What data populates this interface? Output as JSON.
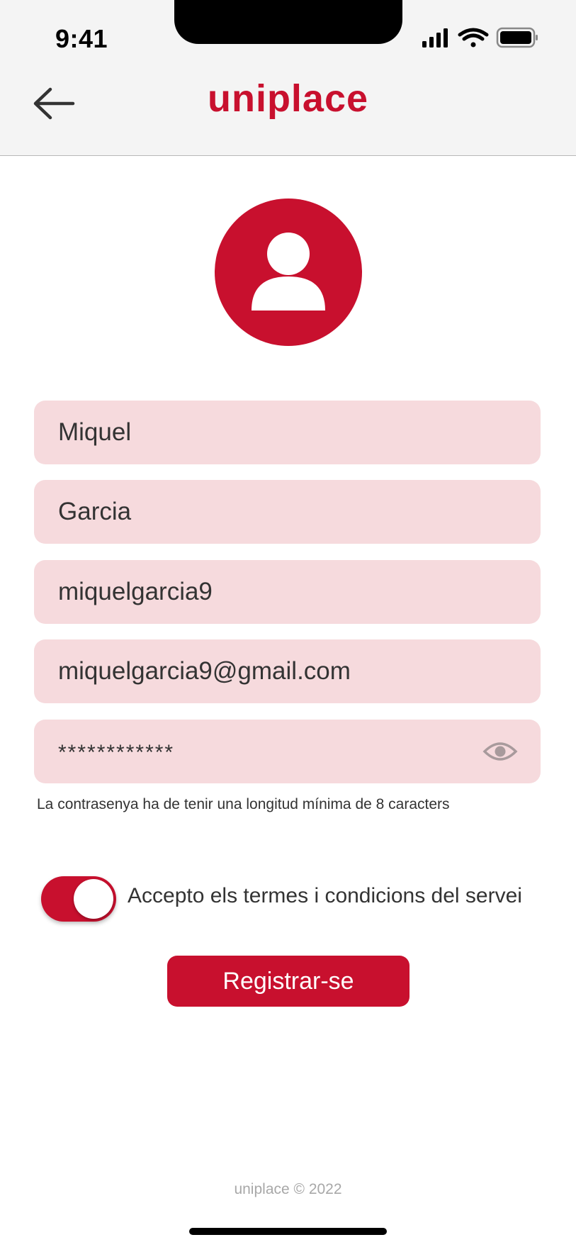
{
  "status_bar": {
    "time": "9:41"
  },
  "header": {
    "title": "uniplace",
    "back_icon": "arrow-left-icon",
    "brand_color": "#c8102e"
  },
  "avatar": {
    "icon": "user-icon"
  },
  "form": {
    "first_name": "Miquel",
    "last_name": "Garcia",
    "username": "miquelgarcia9",
    "email": "miquelgarcia9@gmail.com",
    "password": "************",
    "password_toggle_icon": "eye-icon",
    "password_hint": "La contrasenya ha de tenir una longitud mínima de 8 caracters",
    "field_background": "#f6dadd"
  },
  "terms": {
    "toggle_on": true,
    "label": "Accepto els termes i condicions del servei"
  },
  "actions": {
    "register_label": "Registrar-se"
  },
  "footer": {
    "text": "uniplace © 2022"
  }
}
